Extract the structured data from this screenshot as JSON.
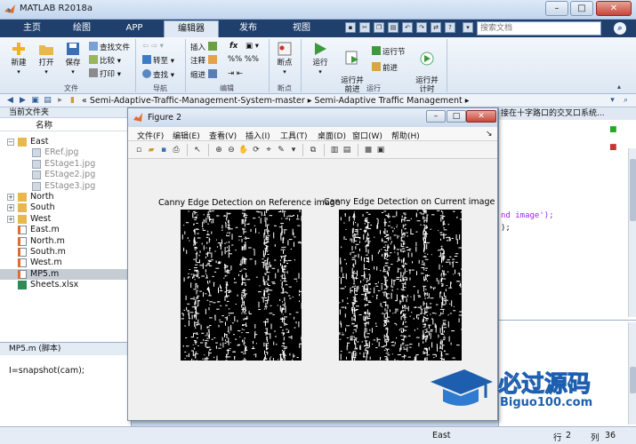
{
  "window": {
    "title": "MATLAB R2018a"
  },
  "tabs": [
    {
      "label": "主页"
    },
    {
      "label": "绘图"
    },
    {
      "label": "APP"
    },
    {
      "label": "编辑器"
    },
    {
      "label": "发布"
    },
    {
      "label": "视图"
    }
  ],
  "search": {
    "placeholder": "搜索文档"
  },
  "ribbon": {
    "file_group": {
      "label": "文件",
      "new": "新建",
      "open": "打开",
      "save": "保存",
      "find_files": "查找文件",
      "compare": "比较",
      "print": "打印"
    },
    "nav_group": {
      "label": "导航",
      "goto": "转至",
      "find": "查找"
    },
    "edit_group": {
      "label": "编辑",
      "insert": "插入",
      "comment": "注释",
      "indent": "缩进",
      "fx": "fx"
    },
    "breakpoint_group": {
      "label": "断点",
      "breakpoints": "断点"
    },
    "run_group": {
      "label": "运行",
      "run": "运行",
      "run_advance": "运行并\n前进",
      "run_section": "运行节",
      "advance": "前进",
      "run_time": "运行并\n计时"
    }
  },
  "address": {
    "path": "«  Semi-Adaptive-Traffic-Management-System-master  ▸  Semi-Adaptive Traffic Management  ▸"
  },
  "file_panel": {
    "title": "当前文件夹",
    "column": "名称",
    "items": [
      {
        "name": "East",
        "kind": "folder",
        "expanded": "−",
        "dim": false
      },
      {
        "name": "ERef.jpg",
        "kind": "image",
        "dim": true
      },
      {
        "name": "EStage1.jpg",
        "kind": "image",
        "dim": true
      },
      {
        "name": "EStage2.jpg",
        "kind": "image",
        "dim": true
      },
      {
        "name": "EStage3.jpg",
        "kind": "image",
        "dim": true
      },
      {
        "name": "North",
        "kind": "folder",
        "expanded": "+",
        "dim": false
      },
      {
        "name": "South",
        "kind": "folder",
        "expanded": "+",
        "dim": false
      },
      {
        "name": "West",
        "kind": "folder",
        "expanded": "+",
        "dim": false
      },
      {
        "name": "East.m",
        "kind": "script",
        "dim": false
      },
      {
        "name": "North.m",
        "kind": "script",
        "dim": false
      },
      {
        "name": "South.m",
        "kind": "script",
        "dim": false
      },
      {
        "name": "West.m",
        "kind": "script",
        "dim": false
      },
      {
        "name": "MP5.m",
        "kind": "script",
        "dim": false
      },
      {
        "name": "Sheets.xlsx",
        "kind": "sheet",
        "dim": false
      }
    ]
  },
  "details": {
    "title": "MP5.m  (脚本)",
    "code": "I=snapshot(cam);"
  },
  "editor": {
    "tab_text": "接在十字路口的交叉口系统...",
    "line1": "nd image');",
    "line2": ");"
  },
  "figure": {
    "title": "Figure 2",
    "menu": [
      "文件(F)",
      "编辑(E)",
      "查看(V)",
      "插入(I)",
      "工具(T)",
      "桌面(D)",
      "窗口(W)",
      "帮助(H)"
    ],
    "plot1_title": "Canny Edge Detection on Reference image",
    "plot2_title": "Canny Edge Detection on Current image"
  },
  "status": {
    "script": "East",
    "row_label": "行",
    "row": "2",
    "col_label": "列",
    "col": "36"
  },
  "watermark": {
    "title": "必过源码",
    "sub": "Biguo100.com"
  },
  "colors": {
    "tab_strip": "#1f3f6c",
    "folder": "#e9b84a",
    "watermark": "#1d5fae"
  }
}
